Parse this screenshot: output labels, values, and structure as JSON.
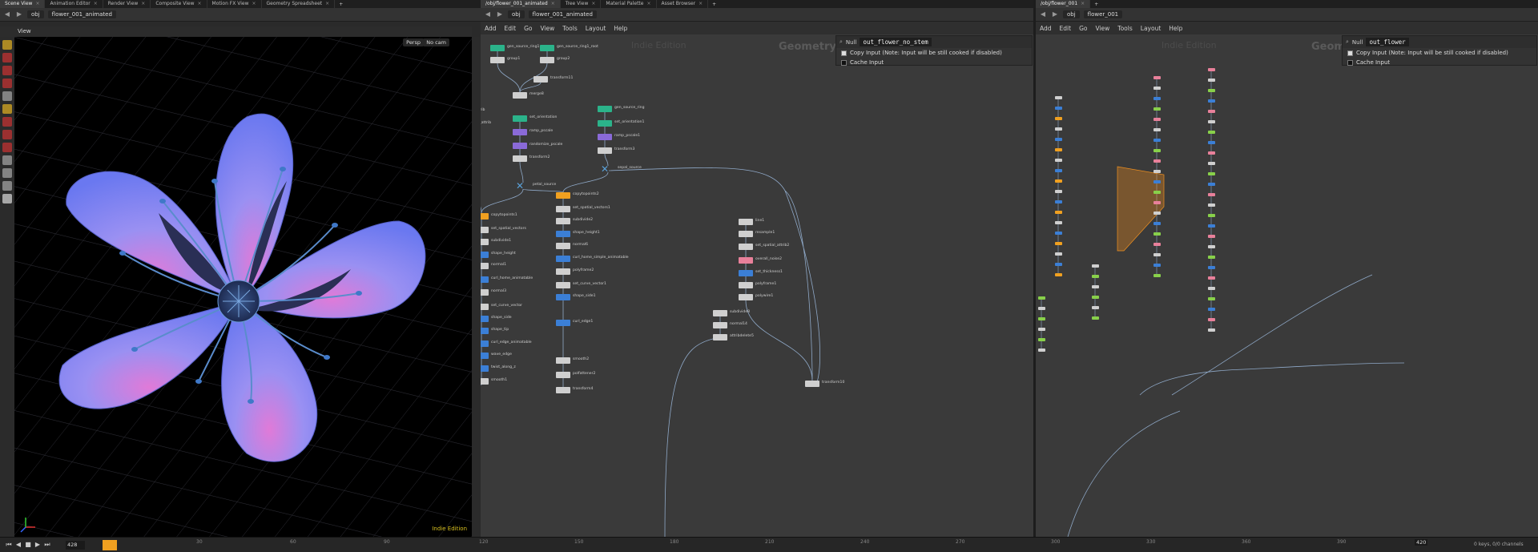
{
  "left": {
    "tabs": [
      "Scene View",
      "Animation Editor",
      "Render View",
      "Composite View",
      "Motion FX View",
      "Geometry Spreadsheet"
    ],
    "path": [
      "obj",
      "flower_001_animated"
    ],
    "view_title": "View",
    "persp": "Persp",
    "cam": "No cam",
    "indie_label": "Indie Edition"
  },
  "middle": {
    "tabs": [
      "/obj/flower_001_animated",
      "Tree View",
      "Material Palette",
      "Asset Browser"
    ],
    "path": [
      "obj",
      "flower_001_animated"
    ],
    "menu": [
      "Add",
      "Edit",
      "Go",
      "View",
      "Tools",
      "Layout",
      "Help"
    ],
    "pane_title": "Geometry",
    "indie": "Indie Edition",
    "param_type": "Null",
    "param_name": "out_flower_no_stem",
    "copy_input": "Copy Input (Note: Input will be still cooked if disabled)",
    "cache_input": "Cache Input",
    "nodes": [
      {
        "label": "gen_source_ring1",
        "color": "#2bb38a"
      },
      {
        "label": "gen_source_ring1_root",
        "color": "#2bb38a"
      },
      {
        "label": "group1",
        "color": "#cfcfcf"
      },
      {
        "label": "group2",
        "color": "#cfcfcf"
      },
      {
        "label": "transform11",
        "color": "#cfcfcf"
      },
      {
        "label": "merge8",
        "color": "#cfcfcf"
      },
      {
        "label": "grid1",
        "color": "#cfcfcf"
      },
      {
        "label": "set_spatial_attrib",
        "color": "#cfcfcf"
      },
      {
        "label": "remap_spatial_attrib",
        "color": "#cfcfcf"
      },
      {
        "label": "pull",
        "color": "#cfcfcf"
      },
      {
        "label": "transform1",
        "color": "#cfcfcf"
      },
      {
        "label": "petal_base",
        "color": "#5aa0d8"
      },
      {
        "label": "set_orientation",
        "color": "#2bb38a"
      },
      {
        "label": "ramp_pscale",
        "color": "#8a6ad8"
      },
      {
        "label": "randomize_pscale",
        "color": "#8a6ad8"
      },
      {
        "label": "transform2",
        "color": "#cfcfcf"
      },
      {
        "label": "petal_source",
        "color": "#5aa0d8"
      },
      {
        "label": "gen_source_ring",
        "color": "#2bb38a"
      },
      {
        "label": "set_orientation1",
        "color": "#2bb38a"
      },
      {
        "label": "ramp_pscale1",
        "color": "#8a6ad8"
      },
      {
        "label": "transform3",
        "color": "#cfcfcf"
      },
      {
        "label": "sepal_source",
        "color": "#5aa0d8"
      },
      {
        "label": "copytopoints1",
        "color": "#f0a020"
      },
      {
        "label": "copytopoints2",
        "color": "#f0a020"
      },
      {
        "label": "set_spatial_vectors",
        "color": "#cfcfcf"
      },
      {
        "label": "subdivide1",
        "color": "#cfcfcf"
      },
      {
        "label": "shape_height",
        "color": "#3b7fd6"
      },
      {
        "label": "normal1",
        "color": "#cfcfcf"
      },
      {
        "label": "curl_home_animatable",
        "color": "#3b7fd6"
      },
      {
        "label": "normal3",
        "color": "#cfcfcf"
      },
      {
        "label": "set_curve_vector",
        "color": "#cfcfcf"
      },
      {
        "label": "shape_side",
        "color": "#3b7fd6"
      },
      {
        "label": "shape_tip",
        "color": "#3b7fd6"
      },
      {
        "label": "curl_edge_animatable",
        "color": "#3b7fd6"
      },
      {
        "label": "wave_edge",
        "color": "#3b7fd6"
      },
      {
        "label": "twist_along_z",
        "color": "#3b7fd6"
      },
      {
        "label": "smooth1",
        "color": "#cfcfcf"
      },
      {
        "label": "groupspromote1",
        "color": "#cfcfcf"
      },
      {
        "label": "groupspromote2",
        "color": "#cfcfcf"
      },
      {
        "label": "connectivity1",
        "color": "#cfcfcf"
      },
      {
        "label": "foreach_begin1",
        "color": "#e08a10"
      },
      {
        "label": "set_spatial_vectors1",
        "color": "#cfcfcf"
      },
      {
        "label": "subdivide2",
        "color": "#cfcfcf"
      },
      {
        "label": "shape_height1",
        "color": "#3b7fd6"
      },
      {
        "label": "normal6",
        "color": "#cfcfcf"
      },
      {
        "label": "curl_home_simple_animatable",
        "color": "#3b7fd6"
      },
      {
        "label": "polyframe2",
        "color": "#cfcfcf"
      },
      {
        "label": "set_curve_vector1",
        "color": "#cfcfcf"
      },
      {
        "label": "shape_side1",
        "color": "#3b7fd6"
      },
      {
        "label": "curl_edge1",
        "color": "#3b7fd6"
      },
      {
        "label": "smooth2",
        "color": "#cfcfcf"
      },
      {
        "label": "polfattener2",
        "color": "#cfcfcf"
      },
      {
        "label": "transform4",
        "color": "#cfcfcf"
      },
      {
        "label": "line1",
        "color": "#cfcfcf"
      },
      {
        "label": "resample1",
        "color": "#cfcfcf"
      },
      {
        "label": "set_spatial_attrib2",
        "color": "#cfcfcf"
      },
      {
        "label": "overall_noise2",
        "color": "#e8809a"
      },
      {
        "label": "set_thickness1",
        "color": "#3b7fd6"
      },
      {
        "label": "polyframe1",
        "color": "#cfcfcf"
      },
      {
        "label": "polywire1",
        "color": "#cfcfcf"
      },
      {
        "label": "subdivide8",
        "color": "#cfcfcf"
      },
      {
        "label": "normal14",
        "color": "#cfcfcf"
      },
      {
        "label": "attribdelete5",
        "color": "#cfcfcf"
      },
      {
        "label": "transform10",
        "color": "#cfcfcf"
      }
    ]
  },
  "right": {
    "tabs": [
      "/obj/flower_001"
    ],
    "path": [
      "obj",
      "flower_001"
    ],
    "menu": [
      "Add",
      "Edit",
      "Go",
      "View",
      "Tools",
      "Layout",
      "Help"
    ],
    "pane_title": "Geometry",
    "indie": "Indie Edition",
    "param_type": "Null",
    "param_name": "out_flower",
    "copy_input": "Copy Input (Note: Input will be still cooked if disabled)",
    "cache_input": "Cache Input"
  },
  "timeline": {
    "frame": "428",
    "end_frame": "420",
    "ticks": [
      "120",
      "150",
      "180",
      "210",
      "240",
      "270",
      "300",
      "330",
      "360",
      "390"
    ],
    "left_ticks": [
      "30",
      "60",
      "90"
    ],
    "keys": "0 keys, 0/0 channels",
    "play_buttons": [
      "⏮",
      "◀",
      "■",
      "▶",
      "⏭"
    ]
  },
  "colors": {
    "bg": "#3a3a3a",
    "viewport": "#000000",
    "petal": "#7b86f0",
    "petal_center": "#d58ae0",
    "accent": "#f0a020"
  }
}
